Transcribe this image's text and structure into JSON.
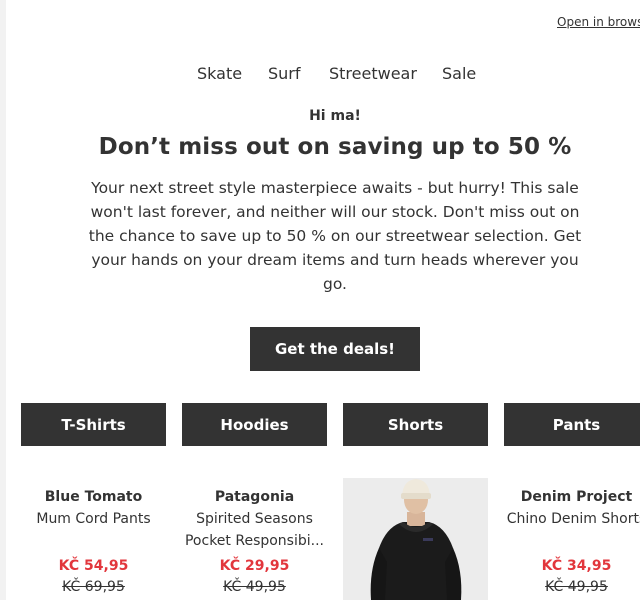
{
  "header": {
    "open_in_browser": "Open in browser"
  },
  "nav": {
    "items": [
      "Skate",
      "Surf",
      "Streetwear",
      "Sale"
    ]
  },
  "hero": {
    "greeting": "Hi ma!",
    "headline": "Don’t miss out on saving up to 50 %",
    "body": "Your next street style masterpiece awaits - but hurry! This sale won't last forever, and neither will our stock. Don't miss out on the chance to save up to 50 % on our streetwear selection. Get your hands on your dream items and turn heads wherever you go.",
    "cta": "Get the deals!"
  },
  "categories": [
    "T-Shirts",
    "Hoodies",
    "Shorts",
    "Pants"
  ],
  "products": [
    {
      "brand": "Blue Tomato",
      "name": "Mum Cord Pants",
      "price": "KČ 54,95",
      "old_price": "KČ 69,95"
    },
    {
      "brand": "Patagonia",
      "name_line1": "Spirited Seasons",
      "name_line2": "Pocket Responsibi...",
      "price": "KČ 29,95",
      "old_price": "KČ 49,95"
    },
    {
      "image": "black-hoodie-model-photo"
    },
    {
      "brand": "Denim Project",
      "name": "Chino Denim Shorts",
      "price": "KČ 34,95",
      "old_price": "KČ 49,95"
    }
  ],
  "colors": {
    "dark": "#333333",
    "sale": "#e2363c",
    "image_bg": "#ececec"
  }
}
